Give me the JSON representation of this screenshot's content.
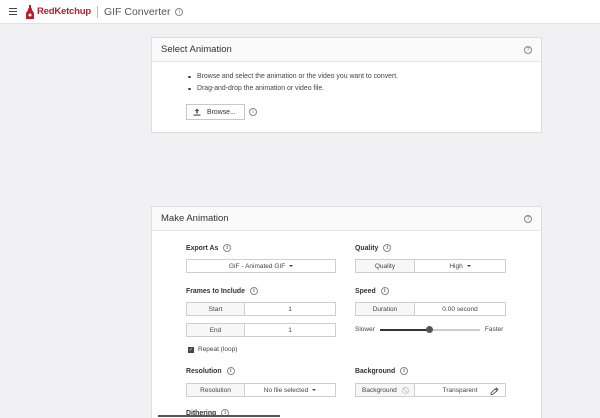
{
  "header": {
    "brand": "RedKetchup",
    "title": "GIF Converter",
    "info_glyph": "i"
  },
  "select_panel": {
    "title": "Select Animation",
    "help_glyph": "?",
    "bullets": [
      "Browse and select the animation or the video you want to convert.",
      "Drag-and-drop the animation or video file."
    ],
    "browse_label": "Browse...",
    "info_glyph": "i"
  },
  "make_panel": {
    "title": "Make Animation",
    "help_glyph": "?",
    "info_glyph": "i",
    "export_as": {
      "label": "Export As",
      "value": "GIF - Animated GIF"
    },
    "quality": {
      "label": "Quality",
      "field": "Quality",
      "value": "High"
    },
    "frames": {
      "label": "Frames to Include",
      "start_label": "Start",
      "start_value": "1",
      "end_label": "End",
      "end_value": "1",
      "repeat_label": "Repeat (loop)",
      "repeat_checked": true,
      "check_glyph": "✓"
    },
    "speed": {
      "label": "Speed",
      "duration_label": "Duration",
      "duration_value": "0.00 second",
      "slower": "Slower",
      "faster": "Faster",
      "level": 0.5
    },
    "resolution": {
      "label": "Resolution",
      "field": "Resolution",
      "value": "No file selected"
    },
    "background": {
      "label": "Background",
      "field": "Background",
      "value": "Transparent"
    },
    "dithering": {
      "label": "Dithering"
    }
  },
  "colors": {
    "brand": "#b81d2e",
    "panel_bg": "#ffffff",
    "page_bg": "#f1f1f3"
  },
  "icons": {
    "menu": "menu-icon",
    "logo": "ketchup-bottle-icon",
    "upload": "upload-icon",
    "info": "info-icon",
    "help": "help-icon",
    "palette": "eyedropper-icon"
  }
}
